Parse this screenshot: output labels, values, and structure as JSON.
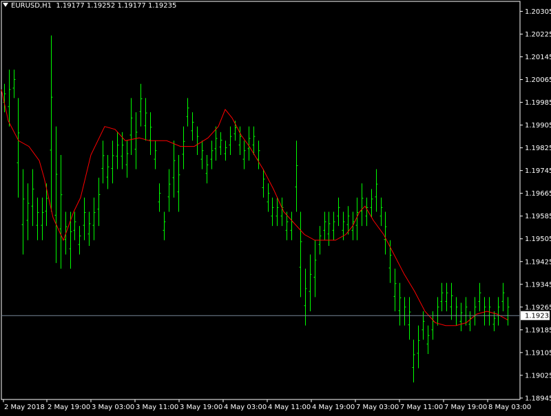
{
  "header": {
    "symbol": "EURUSD,H1",
    "ohlc": "1.19177 1.19252 1.19177 1.19235"
  },
  "colors": {
    "background": "#000000",
    "bars": "#00ff00",
    "ma": "#ff0000",
    "frame": "#ffffff",
    "bid_line": "#778899",
    "price_label_bg": "#ffffff"
  },
  "chart_data": {
    "type": "line",
    "ylim": [
      1.1894,
      1.2034
    ],
    "y_ticks": [
      "1.20305",
      "1.20225",
      "1.20145",
      "1.20065",
      "1.19985",
      "1.19905",
      "1.19825",
      "1.19745",
      "1.19665",
      "1.19585",
      "1.19505",
      "1.19425",
      "1.19345",
      "1.19265",
      "1.19185",
      "1.19105",
      "1.19025",
      "1.18945"
    ],
    "x_labels": [
      "2 May 2018",
      "2 May 19:00",
      "3 May 03:00",
      "3 May 11:00",
      "3 May 19:00",
      "4 May 03:00",
      "4 May 11:00",
      "4 May 19:00",
      "7 May 03:00",
      "7 May 11:00",
      "7 May 19:00",
      "8 May 03:00"
    ],
    "current_price": "1.19235",
    "bars": [
      [
        1.2005,
        1.1995
      ],
      [
        1.201,
        1.199
      ],
      [
        1.201,
        1.2
      ],
      [
        1.2,
        1.1965
      ],
      [
        1.1975,
        1.1945
      ],
      [
        1.197,
        1.195
      ],
      [
        1.1975,
        1.1955
      ],
      [
        1.1965,
        1.195
      ],
      [
        1.1965,
        1.195
      ],
      [
        1.197,
        1.1955
      ],
      [
        1.2022,
        1.196
      ],
      [
        1.199,
        1.1942
      ],
      [
        1.198,
        1.194
      ],
      [
        1.196,
        1.1945
      ],
      [
        1.196,
        1.194
      ],
      [
        1.196,
        1.195
      ],
      [
        1.1955,
        1.1945
      ],
      [
        1.1965,
        1.195
      ],
      [
        1.196,
        1.1948
      ],
      [
        1.1965,
        1.195
      ],
      [
        1.1972,
        1.1955
      ],
      [
        1.1985,
        1.197
      ],
      [
        1.198,
        1.1968
      ],
      [
        1.1985,
        1.197
      ],
      [
        1.1988,
        1.1975
      ],
      [
        1.1988,
        1.1975
      ],
      [
        1.1985,
        1.1972
      ],
      [
        1.2,
        1.198
      ],
      [
        1.1995,
        1.1975
      ],
      [
        1.2005,
        1.199
      ],
      [
        1.2,
        1.1985
      ],
      [
        1.1995,
        1.198
      ],
      [
        1.1985,
        1.1975
      ],
      [
        1.197,
        1.196
      ],
      [
        1.196,
        1.195
      ],
      [
        1.1975,
        1.196
      ],
      [
        1.1985,
        1.1965
      ],
      [
        1.198,
        1.196
      ],
      [
        1.199,
        1.1975
      ],
      [
        1.2,
        1.199
      ],
      [
        1.1995,
        1.1985
      ],
      [
        1.199,
        1.198
      ],
      [
        1.1985,
        1.1975
      ],
      [
        1.198,
        1.197
      ],
      [
        1.1985,
        1.1975
      ],
      [
        1.199,
        1.1978
      ],
      [
        1.1988,
        1.198
      ],
      [
        1.1985,
        1.1978
      ],
      [
        1.199,
        1.198
      ],
      [
        1.1992,
        1.1985
      ],
      [
        1.199,
        1.198
      ],
      [
        1.1985,
        1.1975
      ],
      [
        1.199,
        1.1978
      ],
      [
        1.199,
        1.198
      ],
      [
        1.1985,
        1.1975
      ],
      [
        1.1975,
        1.1965
      ],
      [
        1.197,
        1.196
      ],
      [
        1.1965,
        1.1955
      ],
      [
        1.1965,
        1.1955
      ],
      [
        1.1965,
        1.1955
      ],
      [
        1.196,
        1.195
      ],
      [
        1.196,
        1.195
      ],
      [
        1.1985,
        1.196
      ],
      [
        1.196,
        1.193
      ],
      [
        1.194,
        1.192
      ],
      [
        1.1945,
        1.1925
      ],
      [
        1.195,
        1.193
      ],
      [
        1.1955,
        1.1945
      ],
      [
        1.196,
        1.195
      ],
      [
        1.196,
        1.1948
      ],
      [
        1.196,
        1.195
      ],
      [
        1.1965,
        1.1955
      ],
      [
        1.196,
        1.195
      ],
      [
        1.1962,
        1.1952
      ],
      [
        1.196,
        1.195
      ],
      [
        1.1965,
        1.195
      ],
      [
        1.197,
        1.1955
      ],
      [
        1.1965,
        1.1955
      ],
      [
        1.1968,
        1.1958
      ],
      [
        1.1975,
        1.196
      ],
      [
        1.1965,
        1.1955
      ],
      [
        1.196,
        1.1945
      ],
      [
        1.195,
        1.1935
      ],
      [
        1.194,
        1.1925
      ],
      [
        1.1935,
        1.192
      ],
      [
        1.193,
        1.192
      ],
      [
        1.193,
        1.1915
      ],
      [
        1.1915,
        1.19
      ],
      [
        1.192,
        1.1905
      ],
      [
        1.1925,
        1.1915
      ],
      [
        1.192,
        1.191
      ],
      [
        1.1925,
        1.1915
      ],
      [
        1.193,
        1.192
      ],
      [
        1.1935,
        1.1925
      ],
      [
        1.1935,
        1.1925
      ],
      [
        1.1935,
        1.1922
      ],
      [
        1.193,
        1.192
      ],
      [
        1.1928,
        1.1918
      ],
      [
        1.193,
        1.192
      ],
      [
        1.1925,
        1.1918
      ],
      [
        1.193,
        1.192
      ],
      [
        1.1935,
        1.1925
      ],
      [
        1.193,
        1.192
      ],
      [
        1.193,
        1.192
      ],
      [
        1.1925,
        1.1918
      ],
      [
        1.193,
        1.192
      ],
      [
        1.1935,
        1.1925
      ],
      [
        1.193,
        1.192
      ]
    ],
    "ma": [
      [
        0,
        1.2003
      ],
      [
        10,
        1.1992
      ],
      [
        25,
        1.1985
      ],
      [
        40,
        1.1983
      ],
      [
        55,
        1.1978
      ],
      [
        62,
        1.1972
      ],
      [
        75,
        1.1958
      ],
      [
        90,
        1.195
      ],
      [
        105,
        1.196
      ],
      [
        115,
        1.1965
      ],
      [
        123,
        1.1973
      ],
      [
        130,
        1.198
      ],
      [
        150,
        1.199
      ],
      [
        165,
        1.1989
      ],
      [
        180,
        1.1985
      ],
      [
        200,
        1.1986
      ],
      [
        215,
        1.1985
      ],
      [
        240,
        1.1985
      ],
      [
        260,
        1.1983
      ],
      [
        280,
        1.1983
      ],
      [
        300,
        1.1986
      ],
      [
        315,
        1.199
      ],
      [
        325,
        1.1996
      ],
      [
        335,
        1.1993
      ],
      [
        348,
        1.1987
      ],
      [
        360,
        1.1983
      ],
      [
        380,
        1.1975
      ],
      [
        395,
        1.1968
      ],
      [
        410,
        1.196
      ],
      [
        425,
        1.1956
      ],
      [
        440,
        1.1952
      ],
      [
        455,
        1.195
      ],
      [
        470,
        1.195
      ],
      [
        485,
        1.195
      ],
      [
        500,
        1.1952
      ],
      [
        510,
        1.1955
      ],
      [
        520,
        1.196
      ],
      [
        528,
        1.1962
      ],
      [
        540,
        1.1957
      ],
      [
        555,
        1.1952
      ],
      [
        570,
        1.1945
      ],
      [
        585,
        1.1938
      ],
      [
        600,
        1.1932
      ],
      [
        615,
        1.1925
      ],
      [
        630,
        1.1921
      ],
      [
        645,
        1.192
      ],
      [
        660,
        1.192
      ],
      [
        675,
        1.1921
      ],
      [
        690,
        1.1924
      ],
      [
        705,
        1.1925
      ],
      [
        720,
        1.1924
      ],
      [
        735,
        1.1922
      ]
    ]
  }
}
